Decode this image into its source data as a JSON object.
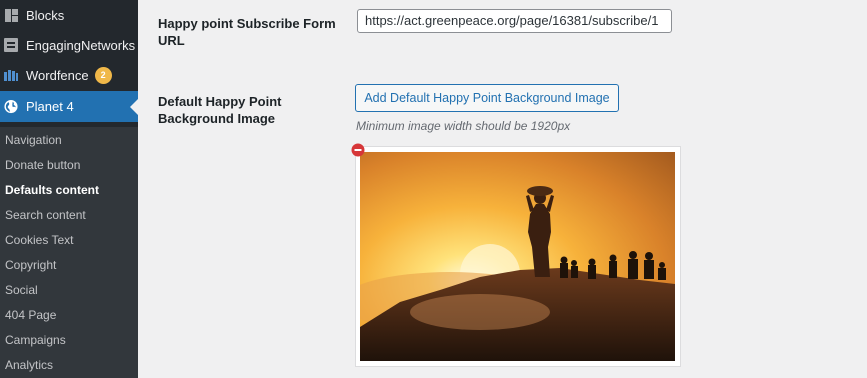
{
  "sidebar": {
    "top_items": [
      {
        "label": "Blocks",
        "icon": "blocks-icon"
      },
      {
        "label": "EngagingNetworks",
        "icon": "engaging-networks-icon"
      },
      {
        "label": "Wordfence",
        "icon": "wordfence-icon",
        "badge": "2"
      },
      {
        "label": "Planet 4",
        "icon": "globe-icon",
        "current": true
      }
    ],
    "sub_items": [
      {
        "label": "Navigation"
      },
      {
        "label": "Donate button"
      },
      {
        "label": "Defaults content",
        "current": true
      },
      {
        "label": "Search content"
      },
      {
        "label": "Cookies Text"
      },
      {
        "label": "Copyright"
      },
      {
        "label": "Social"
      },
      {
        "label": "404 Page"
      },
      {
        "label": "Campaigns"
      },
      {
        "label": "Analytics"
      }
    ]
  },
  "main": {
    "subscribe_url": {
      "label": "Happy point Subscribe Form URL",
      "value": "https://act.greenpeace.org/page/16381/subscribe/1"
    },
    "background_image": {
      "label": "Default Happy Point Background Image",
      "button_label": "Add Default Happy Point Background Image",
      "hint": "Minimum image width should be 1920px"
    }
  },
  "colors": {
    "accent": "#2271b1",
    "sidebar_bg": "#23282d",
    "badge": "#f0b849",
    "remove": "#d63638"
  }
}
